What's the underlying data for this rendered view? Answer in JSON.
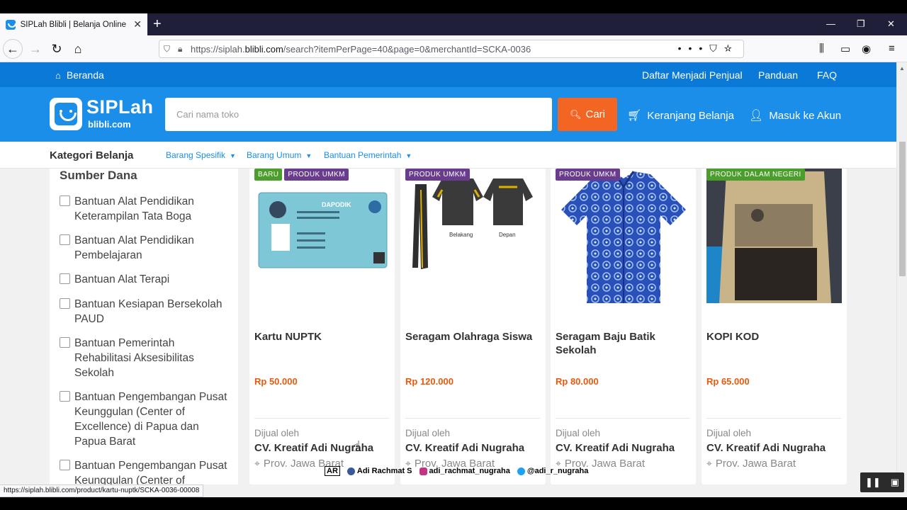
{
  "browser": {
    "tab_title": "SIPLah Blibli | Belanja Online Ke",
    "tab_close": "✕",
    "new_tab": "+",
    "url_prefix": "https://siplah.",
    "url_domain": "blibli.com",
    "url_rest": "/search?itemPerPage=40&page=0&merchantId=SCKA-0036",
    "status_url": "https://siplah.blibli.com/product/kartu-nuptk/SCKA-0036-00008"
  },
  "topnav": {
    "home": "Beranda",
    "links": [
      "Daftar Menjadi Penjual",
      "Panduan",
      "FAQ"
    ]
  },
  "header": {
    "logo_main": "SIPLah",
    "logo_sub": "blibli.com",
    "search_placeholder": "Cari nama toko",
    "search_button": "Cari",
    "cart": "Keranjang Belanja",
    "login": "Masuk ke Akun"
  },
  "categories": {
    "title": "Kategori Belanja",
    "items": [
      "Barang Spesifik",
      "Barang Umum",
      "Bantuan Pemerintah"
    ]
  },
  "filter": {
    "title": "Sumber Dana",
    "items": [
      "Bantuan Alat Pendidikan Keterampilan Tata Boga",
      "Bantuan Alat Pendidikan Pembelajaran",
      "Bantuan Alat Terapi",
      "Bantuan Kesiapan Bersekolah PAUD",
      "Bantuan Pemerintah Rehabilitasi Aksesibilitas Sekolah",
      "Bantuan Pengembangan Pusat Keunggulan (Center of Excellence) di Papua dan Papua Barat",
      "Bantuan Pengembangan Pusat Keunggulan (Center of"
    ]
  },
  "products": [
    {
      "tags": [
        "BARU",
        "PRODUK UMKM"
      ],
      "name": "Kartu NUPTK",
      "price": "Rp 50.000",
      "sold_by": "Dijual oleh",
      "seller": "CV. Kreatif Adi Nugraha",
      "location": "Prov. Jawa Barat",
      "img_text": "DAPODIK"
    },
    {
      "tags": [
        "PRODUK UMKM"
      ],
      "name": "Seragam Olahraga Siswa",
      "price": "Rp 120.000",
      "sold_by": "Dijual oleh",
      "seller": "CV. Kreatif Adi Nugraha",
      "location": "Prov. Jawa Barat",
      "img_text_1": "Belakang",
      "img_text_2": "Depan"
    },
    {
      "tags": [
        "PRODUK UMKM"
      ],
      "name": "Seragam Baju Batik Sekolah",
      "price": "Rp 80.000",
      "sold_by": "Dijual oleh",
      "seller": "CV. Kreatif Adi Nugraha",
      "location": "Prov. Jawa Barat"
    },
    {
      "tags": [
        "PRODUK DALAM NEGERI"
      ],
      "name": "KOPI KOD",
      "price": "Rp 65.000",
      "sold_by": "Dijual oleh",
      "seller": "CV. Kreatif Adi Nugraha",
      "location": "Prov. Jawa Barat"
    }
  ],
  "watermark": {
    "w1": "AR",
    "w2": "Adi Rachmat S",
    "w3": "adi_rachmat_nugraha",
    "w4": "@adi_r_nugraha"
  },
  "colors": {
    "topnav": "#0a79d8",
    "header": "#1a8ee8",
    "search_button": "#f26522",
    "price": "#e8590c",
    "tag_green": "#4b9e2b",
    "tag_purple": "#6a3c8e"
  }
}
